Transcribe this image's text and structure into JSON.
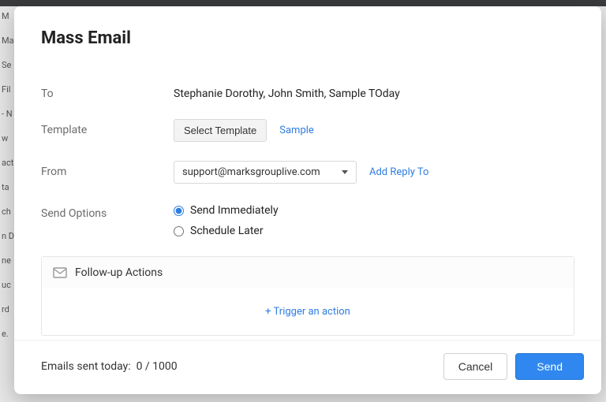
{
  "modal": {
    "title": "Mass Email",
    "to_label": "To",
    "to_value": "Stephanie Dorothy, John Smith, Sample TOday",
    "template_label": "Template",
    "select_template_button": "Select Template",
    "sample_link": "Sample",
    "from_label": "From",
    "from_value": "support@marksgrouplive.com",
    "add_reply_to": "Add Reply To",
    "send_options_label": "Send Options",
    "send_immediately": "Send Immediately",
    "schedule_later": "Schedule Later",
    "followup_title": "Follow-up Actions",
    "trigger_action": "+ Trigger an action",
    "emails_sent_label": "Emails sent today:",
    "emails_sent_value": "0 / 1000",
    "cancel": "Cancel",
    "send": "Send"
  },
  "background_fragments": [
    "M",
    "Ma",
    "Se",
    "Fil",
    "- N",
    "w",
    "act",
    "ta",
    "ch",
    "n D",
    "ne",
    "uc",
    "rd",
    "e."
  ]
}
